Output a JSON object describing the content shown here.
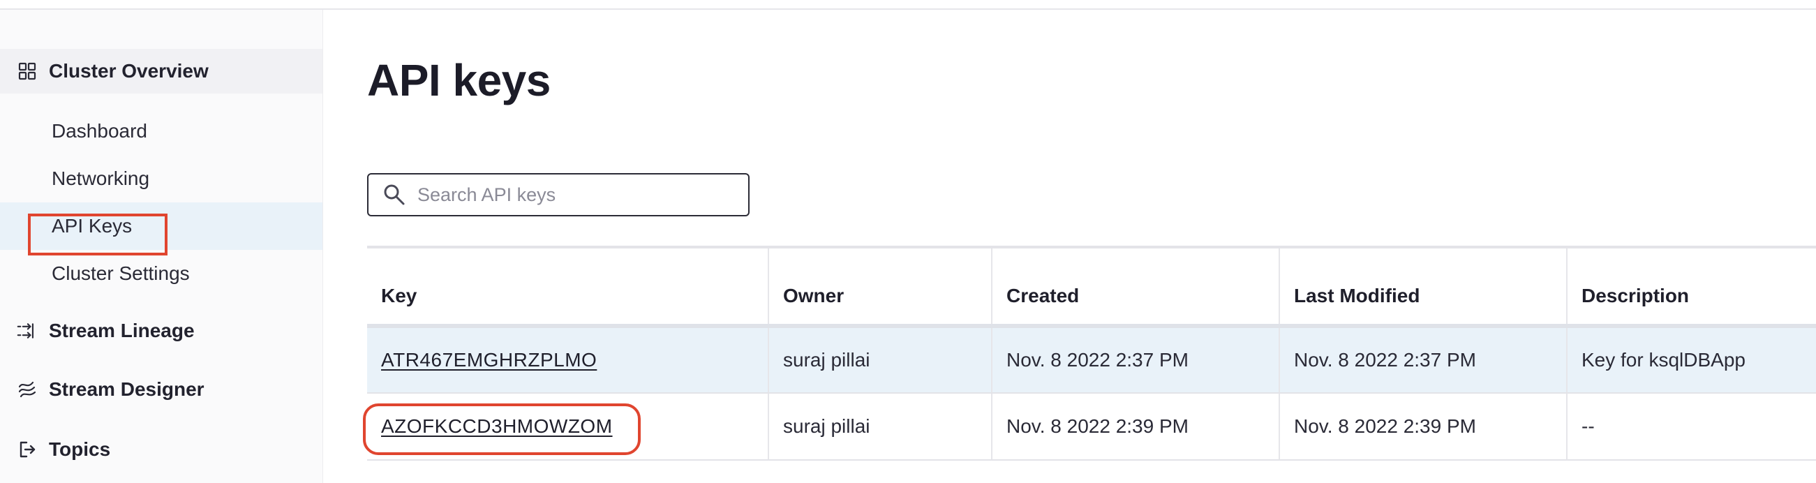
{
  "sidebar": {
    "cluster_overview": "Cluster Overview",
    "items": [
      {
        "label": "Dashboard"
      },
      {
        "label": "Networking"
      },
      {
        "label": "API Keys"
      },
      {
        "label": "Cluster Settings"
      }
    ],
    "stream_lineage": "Stream Lineage",
    "stream_designer": "Stream Designer",
    "topics": "Topics"
  },
  "main": {
    "title": "API keys",
    "search": {
      "placeholder": "Search API keys",
      "value": ""
    },
    "table": {
      "headers": [
        "Key",
        "Owner",
        "Created",
        "Last Modified",
        "Description"
      ],
      "rows": [
        {
          "key": "ATR467EMGHRZPLMO",
          "owner": "suraj pillai",
          "created": "Nov. 8 2022 2:37 PM",
          "modified": "Nov. 8 2022 2:37 PM",
          "description": "Key for ksqlDBApp"
        },
        {
          "key": "AZOFKCCD3HMOWZOM",
          "owner": "suraj pillai",
          "created": "Nov. 8 2022 2:39 PM",
          "modified": "Nov. 8 2022 2:39 PM",
          "description": "--"
        }
      ]
    }
  },
  "colors": {
    "accent_highlight": "#e0452f",
    "selected_row": "#e9f2f9"
  },
  "icons": {
    "cluster_overview": "grid-icon",
    "stream_lineage": "lineage-icon",
    "stream_designer": "designer-icon",
    "topics": "topics-icon",
    "search": "search-icon"
  }
}
